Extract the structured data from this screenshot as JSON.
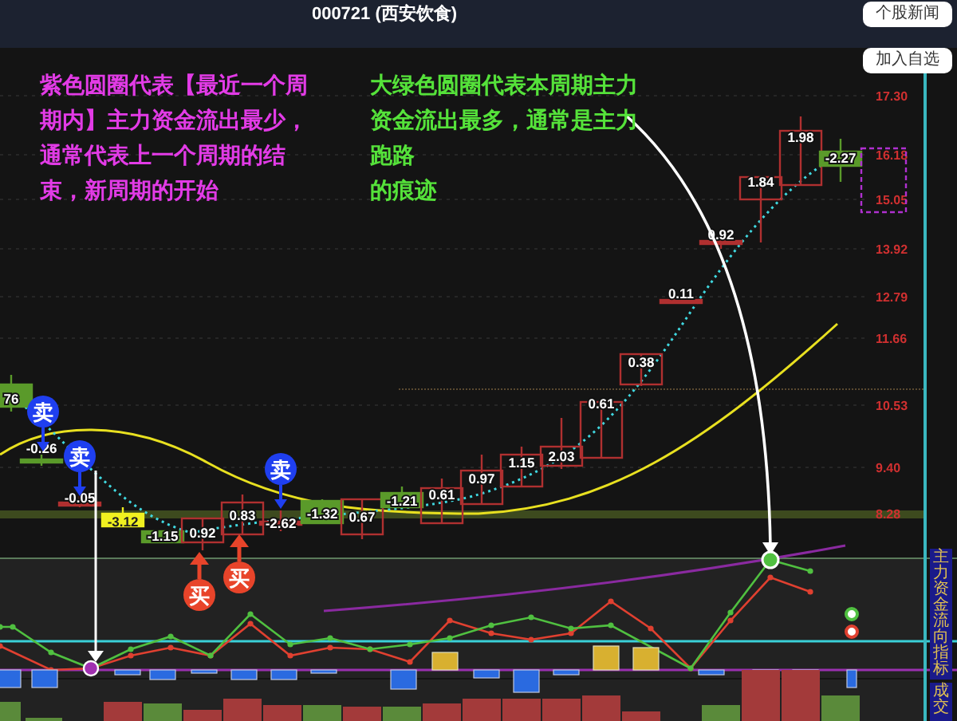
{
  "header": {
    "title": "000721 (西安饮食)",
    "news_button": "个股新闻"
  },
  "watchlist_button": "加入自选",
  "notes": [
    {
      "lines": [
        "紫色圆圈代表【最近一个周",
        "期内】主力资金流出最少，",
        "通常代表上一个周期的结",
        "束，新周期的开始"
      ],
      "color": "#e23be6"
    },
    {
      "lines": [
        "大绿色圆圈代表本周期主力",
        "资金流出最多，通常是主力",
        "跑路",
        "的痕迹"
      ],
      "color": "#55e23a"
    }
  ],
  "price_axis": [
    "17.30",
    "16.18",
    "15.05",
    "13.92",
    "12.79",
    "11.66",
    "10.53",
    "9.40",
    "8.28"
  ],
  "candles": [
    {
      "label": "76",
      "kind": "down"
    },
    {
      "label": "-0.26",
      "kind": "doji-down"
    },
    {
      "label": "-0.05",
      "kind": "doji-up"
    },
    {
      "label": "-3.12",
      "kind": "yellow"
    },
    {
      "label": "-1.15",
      "kind": "down"
    },
    {
      "label": "0.92",
      "kind": "up"
    },
    {
      "label": "0.83",
      "kind": "up"
    },
    {
      "label": "-2.62",
      "kind": "doji-up"
    },
    {
      "label": "-1.32",
      "kind": "down"
    },
    {
      "label": "0.67",
      "kind": "up"
    },
    {
      "label": "-1.21",
      "kind": "down"
    },
    {
      "label": "0.61",
      "kind": "up"
    },
    {
      "label": "0.97",
      "kind": "up"
    },
    {
      "label": "1.15",
      "kind": "up"
    },
    {
      "label": "2.03",
      "kind": "up"
    },
    {
      "label": "0.61",
      "kind": "up"
    },
    {
      "label": "0.38",
      "kind": "up"
    },
    {
      "label": "0.11",
      "kind": "doji-up"
    },
    {
      "label": "0.92",
      "kind": "doji-up"
    },
    {
      "label": "1.84",
      "kind": "up"
    },
    {
      "label": "1.98",
      "kind": "up"
    },
    {
      "label": "-2.27",
      "kind": "down"
    }
  ],
  "signals": [
    {
      "text": "卖",
      "kind": "sell"
    },
    {
      "text": "卖",
      "kind": "sell"
    },
    {
      "text": "卖",
      "kind": "sell"
    },
    {
      "text": "买",
      "kind": "buy"
    },
    {
      "text": "买",
      "kind": "buy"
    }
  ],
  "panels": [
    {
      "label": "主力资金流向指标"
    },
    {
      "label": "成交"
    }
  ]
}
